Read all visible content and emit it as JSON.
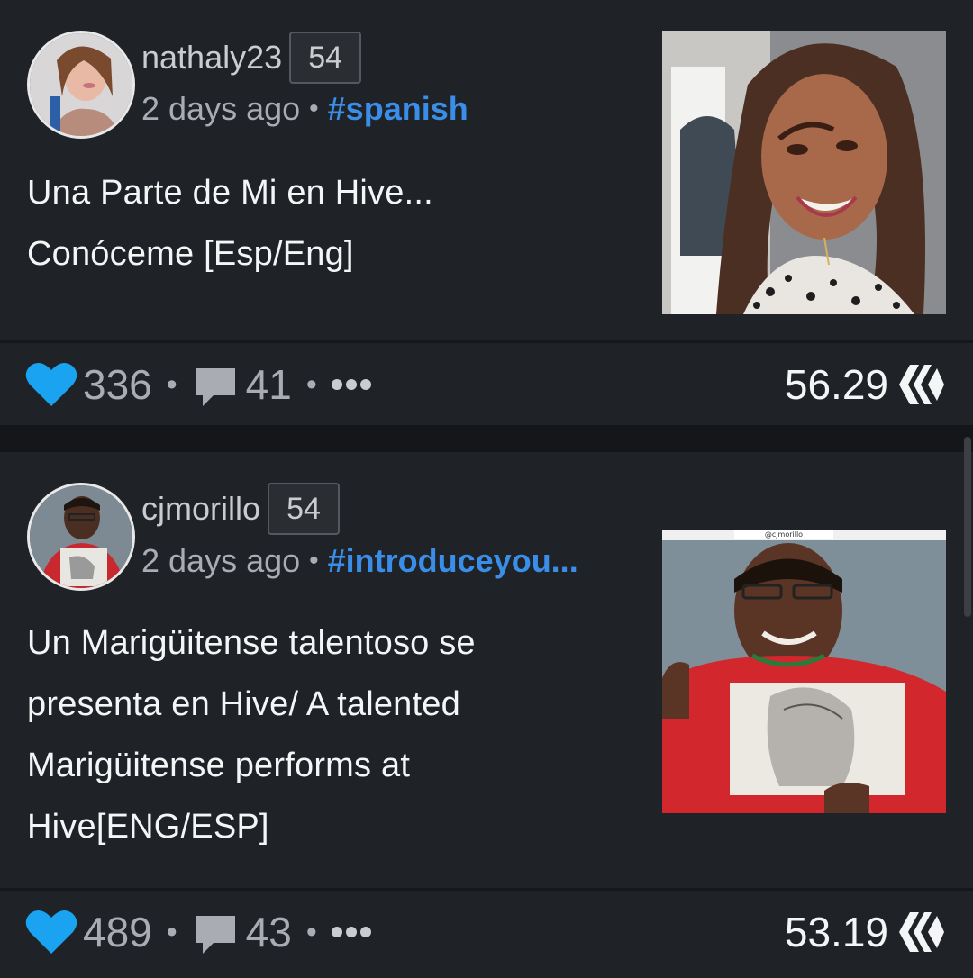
{
  "posts": [
    {
      "author": "nathaly23",
      "reputation": "54",
      "time": "2 days ago",
      "separator": "•",
      "tag": "#spanish",
      "title_lines": [
        "Una Parte de Mi en Hive...",
        "Conóceme [Esp/Eng]"
      ],
      "votes": "336",
      "comments": "41",
      "payout": "56.29",
      "avatar_icon": "avatar-photo",
      "thumbnail_icon": "post-thumbnail-photo"
    },
    {
      "author": "cjmorillo",
      "reputation": "54",
      "time": "2 days ago",
      "separator": "•",
      "tag": "#introduceyou...",
      "title_lines": [
        "Un Marigüitense talentoso se",
        "presenta en Hive/ A talented",
        "Marigüitense performs at",
        "Hive[ENG/ESP]"
      ],
      "thumbnail_caption": "@cjmorillo",
      "votes": "489",
      "comments": "43",
      "payout": "53.19",
      "avatar_icon": "avatar-photo",
      "thumbnail_icon": "post-thumbnail-photo"
    }
  ],
  "icons": {
    "vote": "heart-icon",
    "comment": "comment-icon",
    "more": "more-icon",
    "currency": "hive-logo-icon"
  },
  "colors": {
    "background": "#141619",
    "card": "#1f2226",
    "heart": "#1aa3f0",
    "tag": "#3a8ee8",
    "text_primary": "#f4f5f6",
    "text_secondary": "#a9adb3"
  }
}
